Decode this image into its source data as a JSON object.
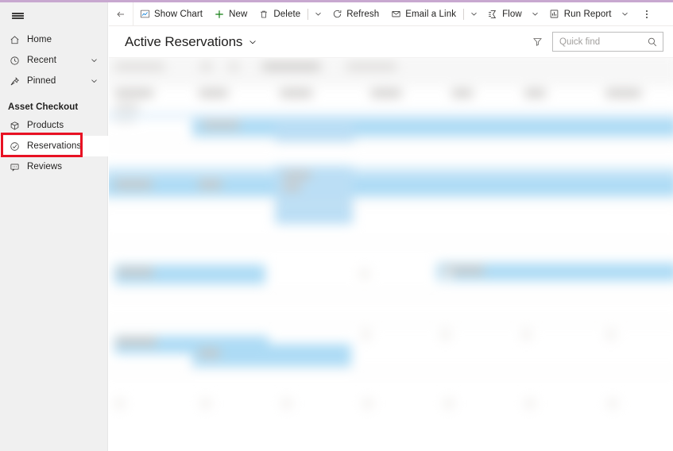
{
  "window": {
    "accent_color": "#c8a8d0",
    "background": "#ffffff"
  },
  "sidebar": {
    "menu_button": {
      "name": "Site map",
      "icon": "hamburger-icon"
    },
    "top_items": [
      {
        "label": "Home",
        "icon": "home-icon",
        "has_chevron": false
      },
      {
        "label": "Recent",
        "icon": "clock-icon",
        "has_chevron": true
      },
      {
        "label": "Pinned",
        "icon": "pin-icon",
        "has_chevron": true
      }
    ],
    "group": {
      "label": "Asset Checkout",
      "items": [
        {
          "label": "Products",
          "icon": "box-icon",
          "selected": false
        },
        {
          "label": "Reservations",
          "icon": "check-circle-icon",
          "selected": true
        },
        {
          "label": "Reviews",
          "icon": "comment-icon",
          "selected": false
        }
      ]
    }
  },
  "annotation": {
    "target": "Reservations",
    "color": "#e81123"
  },
  "command_bar": {
    "back": {
      "label": "Back",
      "icon": "arrow-left-icon"
    },
    "commands": [
      {
        "label": "Show Chart",
        "icon": "chart-icon",
        "icon_color": "#605e5c",
        "caret": false
      },
      {
        "label": "New",
        "icon": "plus-icon",
        "icon_color": "#107c10",
        "caret": false
      },
      {
        "label": "Delete",
        "icon": "trash-icon",
        "icon_color": "#605e5c",
        "caret": true,
        "separator_before_caret": true
      },
      {
        "label": "Refresh",
        "icon": "refresh-icon",
        "icon_color": "#605e5c",
        "caret": false
      },
      {
        "label": "Email a Link",
        "icon": "email-icon",
        "icon_color": "#605e5c",
        "caret": true,
        "separator_before_caret": true
      },
      {
        "label": "Flow",
        "icon": "flow-icon",
        "icon_color": "#605e5c",
        "caret": true
      },
      {
        "label": "Run Report",
        "icon": "report-icon",
        "icon_color": "#605e5c",
        "caret": true
      }
    ],
    "overflow": {
      "label": "More commands",
      "icon": "ellipsis-vertical-icon"
    }
  },
  "view_header": {
    "title": "Active Reservations",
    "title_caret_icon": "chevron-down-icon",
    "filter": {
      "label": "Filter",
      "icon": "filter-icon"
    },
    "search": {
      "placeholder": "Quick find",
      "value": "",
      "icon": "search-icon"
    }
  },
  "grid": {
    "state": "blurred",
    "note": "Record grid content is blurred/redacted in the screenshot",
    "selected_row_color": "#addbf5",
    "header_band_color": "#f7f7f7"
  }
}
